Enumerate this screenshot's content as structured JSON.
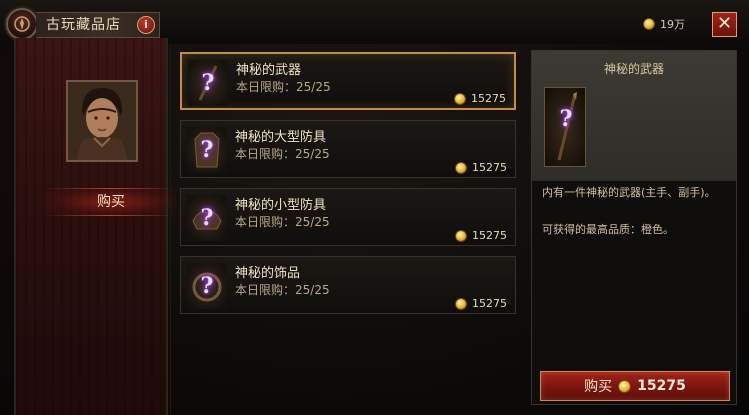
{
  "header": {
    "title": "古玩藏品店",
    "info_label": "i",
    "currency_amount": "19万",
    "close_label": "✕"
  },
  "sidebar": {
    "tab_buy": "购买"
  },
  "items": [
    {
      "name": "神秘的武器",
      "limit": "本日限购：25/25",
      "price": "15275",
      "icon": "mystery-weapon-icon"
    },
    {
      "name": "神秘的大型防具",
      "limit": "本日限购：25/25",
      "price": "15275",
      "icon": "mystery-large-armor-icon"
    },
    {
      "name": "神秘的小型防具",
      "limit": "本日限购：25/25",
      "price": "15275",
      "icon": "mystery-small-armor-icon"
    },
    {
      "name": "神秘的饰品",
      "limit": "本日限购：25/25",
      "price": "15275",
      "icon": "mystery-accessory-icon"
    }
  ],
  "detail": {
    "title": "神秘的武器",
    "description": "内有一件神秘的武器(主手、副手)。",
    "quality": "可获得的最高品质：橙色。",
    "buy_label": "购买",
    "price": "15275"
  },
  "colors": {
    "accent_gold": "#c78a43",
    "button_red": "#a22319",
    "mystery_purple": "#b24cff"
  }
}
